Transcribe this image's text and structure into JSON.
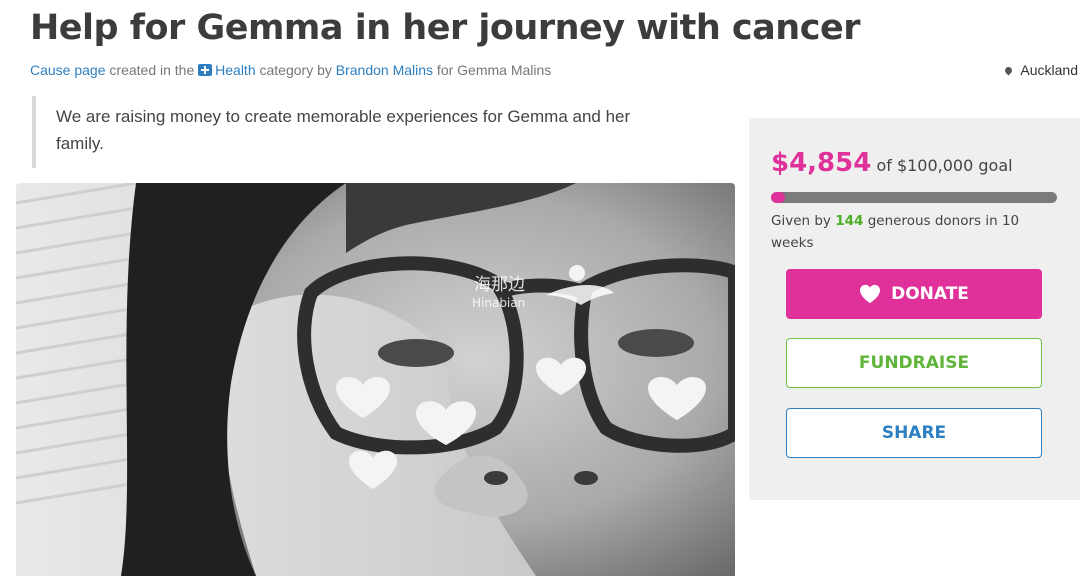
{
  "page": {
    "title": "Help for Gemma in her journey with cancer",
    "meta": {
      "cause_link": "Cause page",
      "created_text": " created in the ",
      "category": "Health",
      "by_text": " category by ",
      "creator": "Brandon Malins",
      "for_text": " for ",
      "beneficiary": "Gemma Malins"
    },
    "location": "Auckland",
    "description": "We are raising money to create memorable experiences for Gemma and her family."
  },
  "photo": {
    "watermark_cn": "海那边",
    "watermark_en": "Hinabian"
  },
  "donation_panel": {
    "amount_raised": "$4,854",
    "goal_text": "of $100,000 goal",
    "progress_fraction": 0.04854,
    "given_by_prefix": "Given by ",
    "donor_count": "144",
    "given_by_suffix": " generous donors in 10 weeks",
    "donate_label": "DONATE",
    "fundraise_label": "FUNDRAISE",
    "share_label": "SHARE"
  },
  "colors": {
    "accent_pink": "#e0319b",
    "link_blue": "#2d7fc1",
    "fundraise_green": "#74c14a",
    "donor_count_green": "#4caf24",
    "panel_bg": "#efefef"
  }
}
